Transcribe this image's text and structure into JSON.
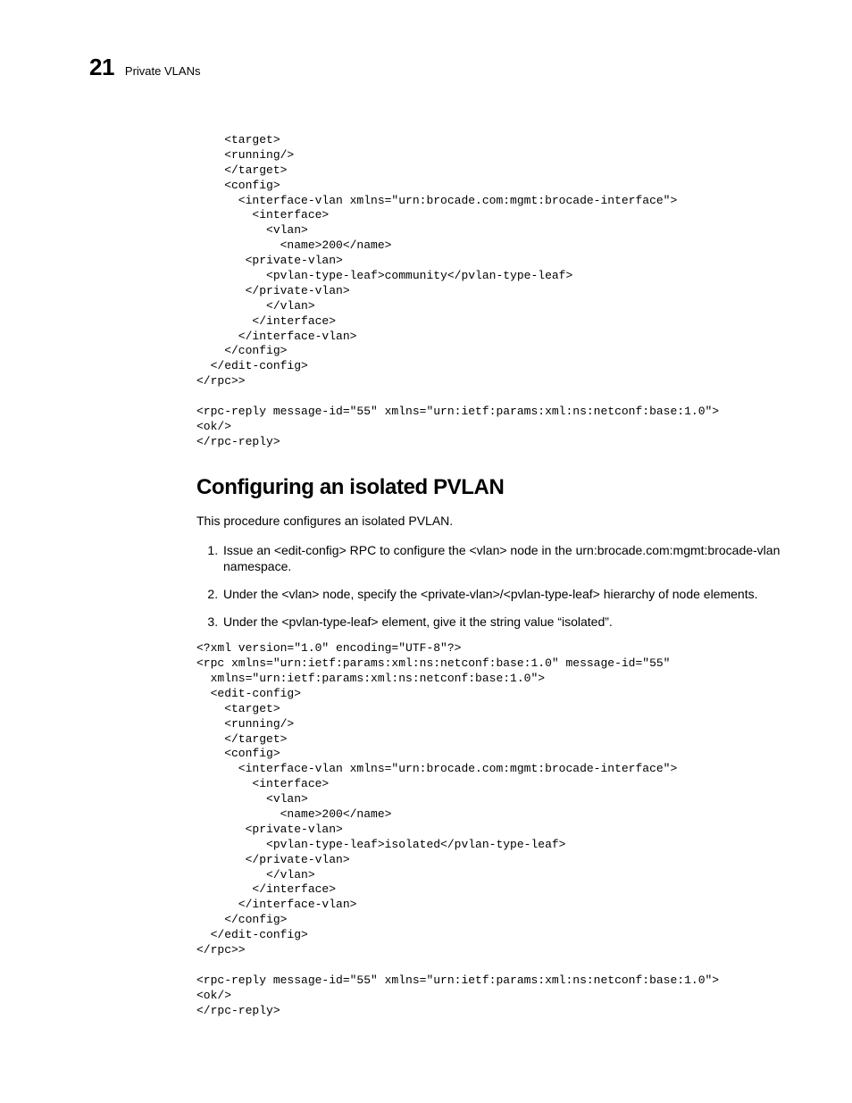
{
  "header": {
    "page_number": "21",
    "running_title": "Private VLANs"
  },
  "code_block_top": "    <target>\n    <running/>\n    </target>\n    <config>\n      <interface-vlan xmlns=\"urn:brocade.com:mgmt:brocade-interface\">\n        <interface>\n          <vlan>\n            <name>200</name>\n       <private-vlan>\n          <pvlan-type-leaf>community</pvlan-type-leaf>\n       </private-vlan>\n          </vlan>\n        </interface>\n      </interface-vlan>\n    </config>\n  </edit-config>\n</rpc>>\n\n<rpc-reply message-id=\"55\" xmlns=\"urn:ietf:params:xml:ns:netconf:base:1.0\">\n<ok/>\n</rpc-reply>",
  "section": {
    "heading": "Configuring an isolated PVLAN",
    "intro": "This procedure configures an isolated PVLAN.",
    "steps": [
      "Issue an <edit-config> RPC to configure the <vlan> node in the urn:brocade.com:mgmt:brocade-vlan namespace.",
      "Under the <vlan> node, specify the <private-vlan>/<pvlan-type-leaf> hierarchy of node elements.",
      "Under the <pvlan-type-leaf> element, give it the string value “isolated”."
    ]
  },
  "code_block_bottom": "<?xml version=\"1.0\" encoding=\"UTF-8\"?>\n<rpc xmlns=\"urn:ietf:params:xml:ns:netconf:base:1.0\" message-id=\"55\"\n  xmlns=\"urn:ietf:params:xml:ns:netconf:base:1.0\">\n  <edit-config>\n    <target>\n    <running/>\n    </target>\n    <config>\n      <interface-vlan xmlns=\"urn:brocade.com:mgmt:brocade-interface\">\n        <interface>\n          <vlan>\n            <name>200</name>\n       <private-vlan>\n          <pvlan-type-leaf>isolated</pvlan-type-leaf>\n       </private-vlan>\n          </vlan>\n        </interface>\n      </interface-vlan>\n    </config>\n  </edit-config>\n</rpc>>\n\n<rpc-reply message-id=\"55\" xmlns=\"urn:ietf:params:xml:ns:netconf:base:1.0\">\n<ok/>\n</rpc-reply>"
}
